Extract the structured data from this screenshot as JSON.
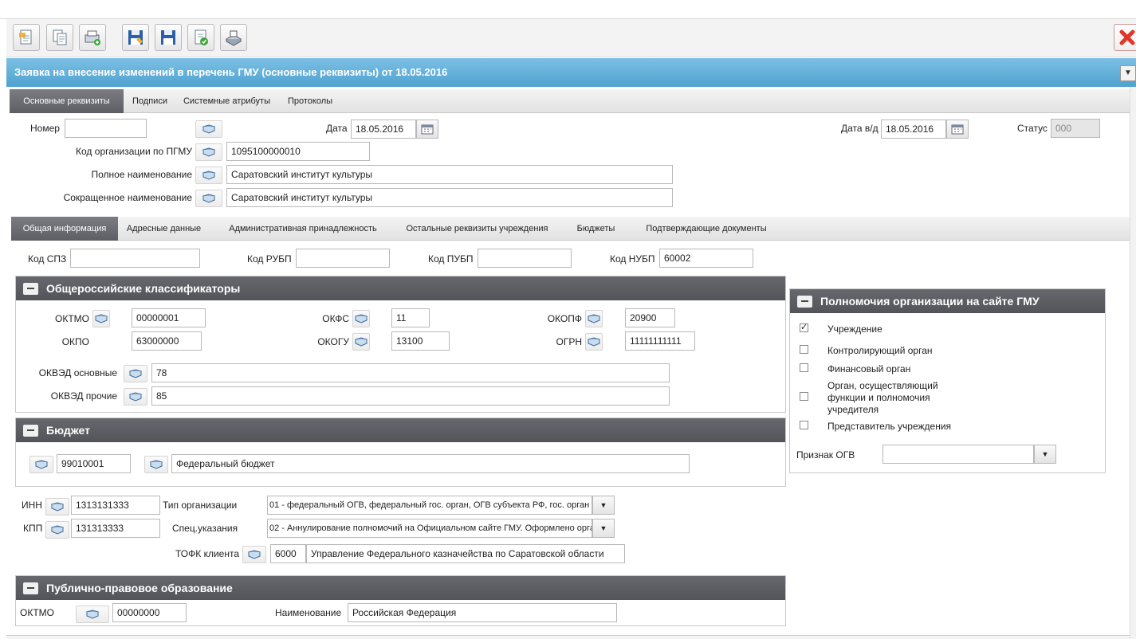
{
  "toolbar": {
    "buttons": [
      "new-document-icon",
      "copy-document-icon",
      "add-print-icon",
      "save-as-icon",
      "save-icon",
      "approve-document-icon",
      "print-icon"
    ],
    "close_icon": "close-red-icon"
  },
  "title": "Заявка на внесение изменений в перечень ГМУ (основные реквизиты) от 18.05.2016",
  "main_tabs": [
    "Основные реквизиты",
    "Подписи",
    "Системные атрибуты",
    "Протоколы"
  ],
  "header": {
    "nomer_label": "Номер",
    "nomer_value": "",
    "date_label": "Дата",
    "date_value": "18.05.2016",
    "datevd_label": "Дата в/д",
    "datevd_value": "18.05.2016",
    "status_label": "Статус",
    "status_value": "000",
    "org_code_label": "Код организации по ПГМУ",
    "org_code_value": "1095100000010",
    "full_name_label": "Полное наименование",
    "full_name_value": "Саратовский институт культуры",
    "short_name_label": "Сокращенное наименование",
    "short_name_value": "Саратовский институт культуры"
  },
  "sub_tabs": [
    "Общая информация",
    "Адресные данные",
    "Административная принадлежность",
    "Остальные реквизиты учреждения",
    "Бюджеты",
    "Подтверждающие документы"
  ],
  "codes": {
    "spz_label": "Код СПЗ",
    "spz_value": "",
    "rubp_label": "Код РУБП",
    "rubp_value": "",
    "pubp_label": "Код ПУБП",
    "pubp_value": "",
    "nubp_label": "Код НУБП",
    "nubp_value": "60002"
  },
  "classifiers": {
    "title": "Общероссийские классификаторы",
    "oktmo_label": "ОКТМО",
    "oktmo_value": "00000001",
    "okfs_label": "ОКФС",
    "okfs_value": "11",
    "okopf_label": "ОКОПФ",
    "okopf_value": "20900",
    "okpo_label": "ОКПО",
    "okpo_value": "63000000",
    "okogu_label": "ОКОГУ",
    "okogu_value": "13100",
    "ogrn_label": "ОГРН",
    "ogrn_value": "11111111111",
    "okved_main_label": "ОКВЭД основные",
    "okved_main_value": "78",
    "okved_other_label": "ОКВЭД прочие",
    "okved_other_value": "85"
  },
  "budget": {
    "title": "Бюджет",
    "code_value": "99010001",
    "name_value": "Федеральный бюджет"
  },
  "org": {
    "inn_label": "ИНН",
    "inn_value": "1313131333",
    "kpp_label": "КПП",
    "kpp_value": "131313333",
    "type_label": "Тип организации",
    "type_value": "01 - федеральный ОГВ, федеральный гос. орган, ОГВ субъекта РФ, гос. орган с",
    "spec_label": "Спец.указания",
    "spec_value": "02 - Аннулирование полномочий на Официальном сайте ГМУ. Оформлено орга",
    "tofk_label": "ТОФК клиента",
    "tofk_code": "6000",
    "tofk_name": "Управление Федерального казначейства по Саратовской области"
  },
  "public": {
    "title": "Публично-правовое образование",
    "oktmo_label": "ОКТМО",
    "oktmo_value": "00000000",
    "name_label": "Наименование",
    "name_value": "Российская Федерация"
  },
  "powers": {
    "title": "Полномочия организации на сайте ГМУ",
    "items": [
      {
        "label": "Учреждение",
        "checked": true
      },
      {
        "label": "Контролирующий орган",
        "checked": false
      },
      {
        "label": "Финансовый орган",
        "checked": false
      },
      {
        "label_lines": [
          "Орган, осуществляющий",
          "функции и полномочия",
          "учредителя"
        ],
        "checked": false
      },
      {
        "label": "Представитель учреждения",
        "checked": false
      }
    ],
    "ogv_label": "Признак ОГВ",
    "ogv_value": ""
  }
}
